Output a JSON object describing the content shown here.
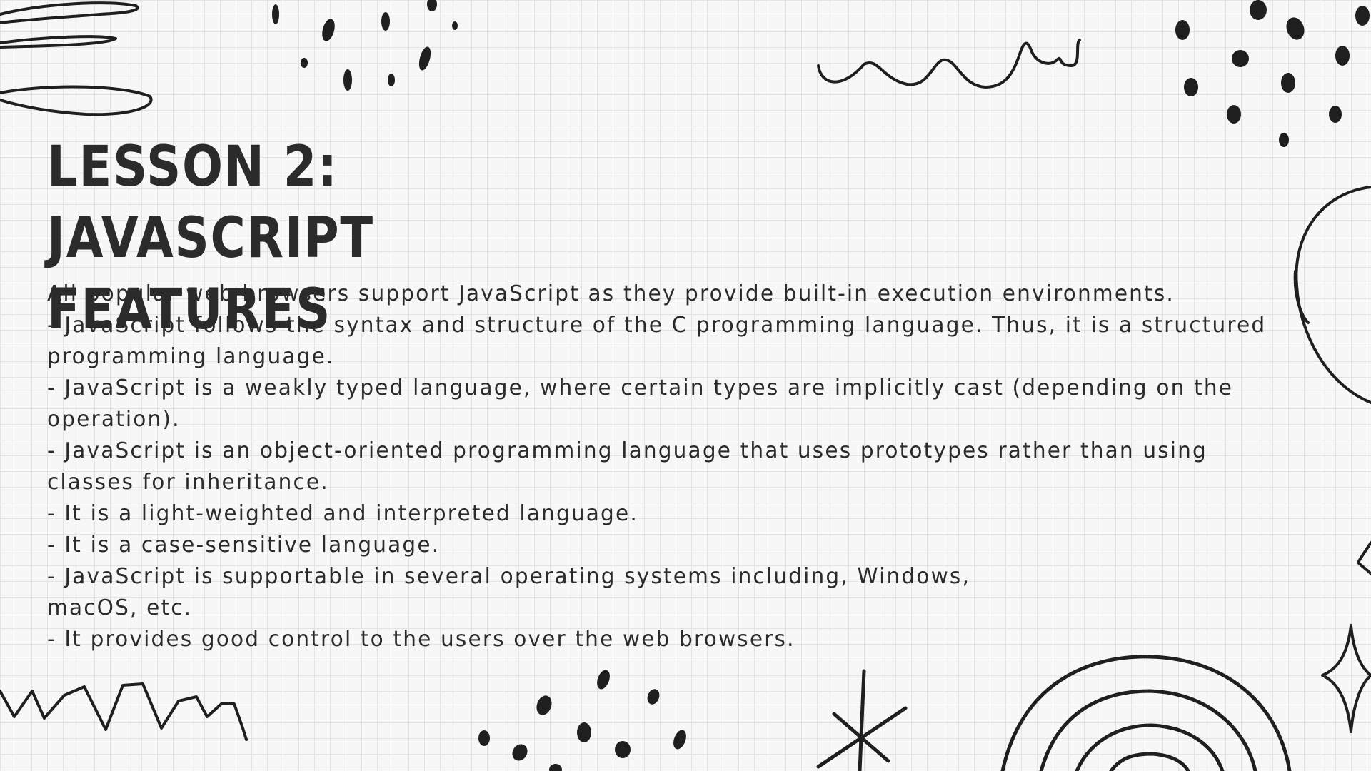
{
  "slide": {
    "title": "Lesson 2: JavaScript Features",
    "body": "All popular web browsers support JavaScript as they provide built-in execution environments.\n- JavaScript follows the syntax and structure of the C programming language. Thus, it is a structured programming language.\n- JavaScript is a weakly typed language, where certain types are implicitly cast (depending on the operation).\n- JavaScript is an object-oriented programming language that uses prototypes rather than using classes for inheritance.\n- It is a light-weighted and interpreted language.\n- It is a case-sensitive language.\n- JavaScript is supportable in several operating systems including, Windows,\nmacOS, etc.\n- It provides good control to the users over the web browsers."
  },
  "decorations": [
    "scribble-loops",
    "ink-dots",
    "wavy-line",
    "circle-outline",
    "zigzag-line",
    "asterisk-star",
    "concentric-arcs",
    "sparkle-star"
  ],
  "colors": {
    "background": "#f7f7f7",
    "grid": "#e3e3e3",
    "ink": "#1f1f1f",
    "text": "#2b2b2b"
  }
}
